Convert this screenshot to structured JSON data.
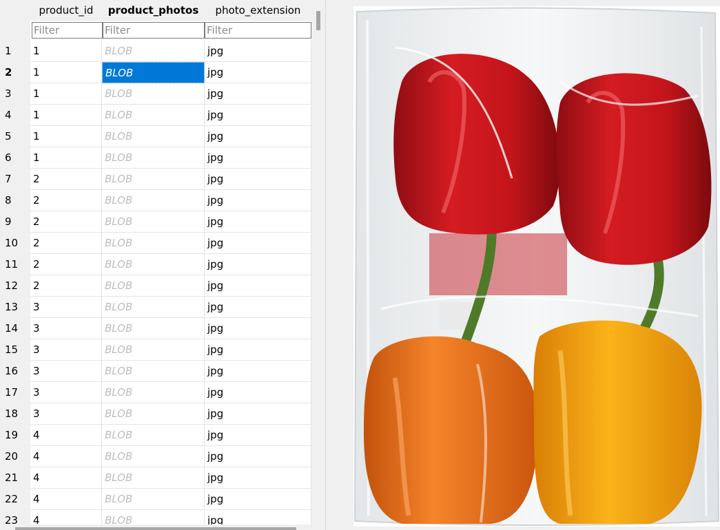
{
  "grid": {
    "columns": [
      {
        "label": "product_id",
        "bold": false
      },
      {
        "label": "product_photos",
        "bold": true
      },
      {
        "label": "photo_extension",
        "bold": false
      }
    ],
    "filter_placeholder": "Filter",
    "selected_row": 2,
    "rows": [
      {
        "num": "1",
        "product_id": "1",
        "product_photos": "BLOB",
        "photo_extension": "jpg"
      },
      {
        "num": "2",
        "product_id": "1",
        "product_photos": "BLOB",
        "photo_extension": "jpg"
      },
      {
        "num": "3",
        "product_id": "1",
        "product_photos": "BLOB",
        "photo_extension": "jpg"
      },
      {
        "num": "4",
        "product_id": "1",
        "product_photos": "BLOB",
        "photo_extension": "jpg"
      },
      {
        "num": "5",
        "product_id": "1",
        "product_photos": "BLOB",
        "photo_extension": "jpg"
      },
      {
        "num": "6",
        "product_id": "1",
        "product_photos": "BLOB",
        "photo_extension": "jpg"
      },
      {
        "num": "7",
        "product_id": "2",
        "product_photos": "BLOB",
        "photo_extension": "jpg"
      },
      {
        "num": "8",
        "product_id": "2",
        "product_photos": "BLOB",
        "photo_extension": "jpg"
      },
      {
        "num": "9",
        "product_id": "2",
        "product_photos": "BLOB",
        "photo_extension": "jpg"
      },
      {
        "num": "10",
        "product_id": "2",
        "product_photos": "BLOB",
        "photo_extension": "jpg"
      },
      {
        "num": "11",
        "product_id": "2",
        "product_photos": "BLOB",
        "photo_extension": "jpg"
      },
      {
        "num": "12",
        "product_id": "2",
        "product_photos": "BLOB",
        "photo_extension": "jpg"
      },
      {
        "num": "13",
        "product_id": "3",
        "product_photos": "BLOB",
        "photo_extension": "jpg"
      },
      {
        "num": "14",
        "product_id": "3",
        "product_photos": "BLOB",
        "photo_extension": "jpg"
      },
      {
        "num": "15",
        "product_id": "3",
        "product_photos": "BLOB",
        "photo_extension": "jpg"
      },
      {
        "num": "16",
        "product_id": "3",
        "product_photos": "BLOB",
        "photo_extension": "jpg"
      },
      {
        "num": "17",
        "product_id": "3",
        "product_photos": "BLOB",
        "photo_extension": "jpg"
      },
      {
        "num": "18",
        "product_id": "3",
        "product_photos": "BLOB",
        "photo_extension": "jpg"
      },
      {
        "num": "19",
        "product_id": "4",
        "product_photos": "BLOB",
        "photo_extension": "jpg"
      },
      {
        "num": "20",
        "product_id": "4",
        "product_photos": "BLOB",
        "photo_extension": "jpg"
      },
      {
        "num": "21",
        "product_id": "4",
        "product_photos": "BLOB",
        "photo_extension": "jpg"
      },
      {
        "num": "22",
        "product_id": "4",
        "product_photos": "BLOB",
        "photo_extension": "jpg"
      },
      {
        "num": "23",
        "product_id": "4",
        "product_photos": "BLOB",
        "photo_extension": "jpg"
      }
    ]
  },
  "colors": {
    "selection": "#0078d7",
    "blob_text": "#bdbdbd",
    "pepper_red": "#c8161d",
    "pepper_orange": "#f07a1a",
    "pepper_yellow": "#f6a50e",
    "stem_green": "#4f7a2a"
  },
  "image_preview": {
    "description_icon": "bell-peppers-in-bag-image"
  }
}
